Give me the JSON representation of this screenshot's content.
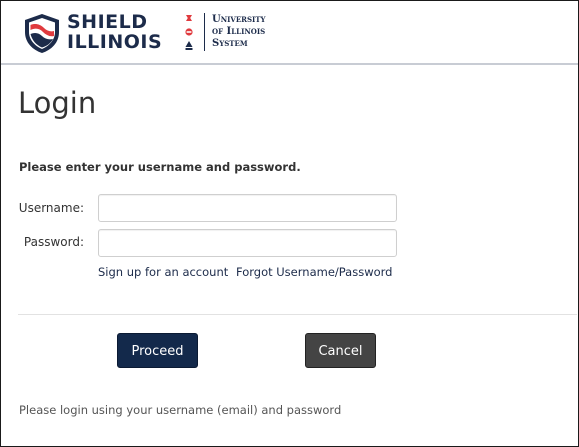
{
  "header": {
    "brand_line1": "SHIELD",
    "brand_line2": "ILLINOIS",
    "system_line1": "University",
    "system_line2": "of Illinois",
    "system_line3": "System",
    "logo_icon": "shield-illinois-logo-icon",
    "emblem_icon": "uis-emblem-icon"
  },
  "page": {
    "title": "Login",
    "instructions": "Please enter your username and password."
  },
  "form": {
    "username_label": "Username:",
    "username_value": "",
    "password_label": "Password:",
    "password_value": "",
    "signup_link": "Sign up for an account",
    "forgot_link": "Forgot Username/Password"
  },
  "actions": {
    "proceed_label": "Proceed",
    "cancel_label": "Cancel"
  },
  "footer": {
    "note": "Please login using your username (email) and password"
  },
  "colors": {
    "navy": "#13294b",
    "brand_red": "#e03a3e",
    "cancel_gray": "#444444"
  }
}
